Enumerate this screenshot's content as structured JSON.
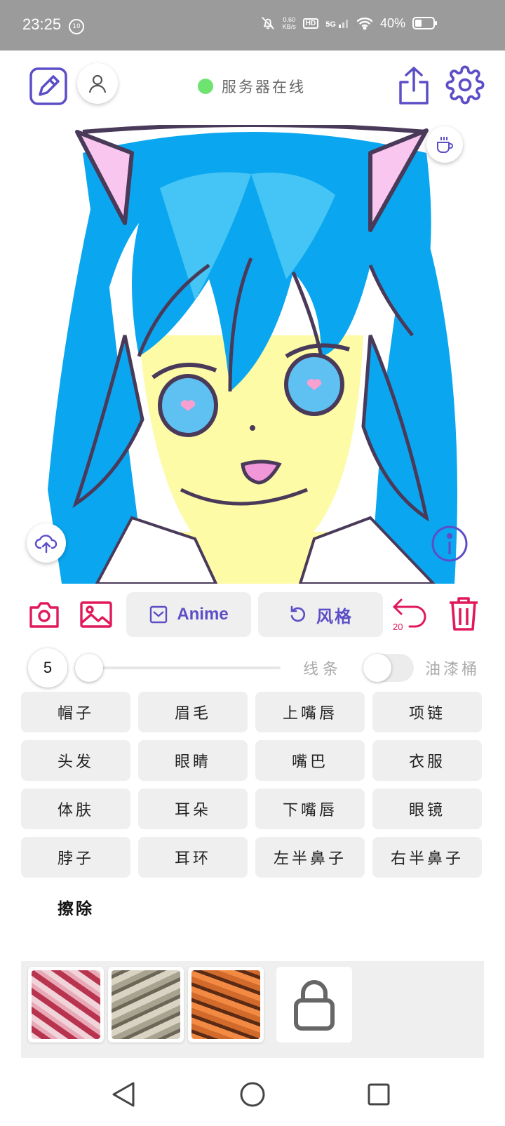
{
  "status_bar": {
    "time": "23:25",
    "notification_badge": "10",
    "net_speed_value": "0.60",
    "net_speed_unit": "KB/s",
    "hd_label": "HD",
    "signal_label": "5G",
    "battery": "40%"
  },
  "header": {
    "server_status": "服务器在线",
    "server_status_color": "#6fe36f"
  },
  "toolbar": {
    "anime_label": "Anime",
    "style_label": "风格",
    "undo_count": "20"
  },
  "brush": {
    "size": "5",
    "slider_fraction": 0.0,
    "line_label": "线条",
    "bucket_label": "油漆桶",
    "bucket_enabled": false
  },
  "parts": [
    "帽子",
    "眉毛",
    "上嘴唇",
    "项链",
    "头发",
    "眼睛",
    "嘴巴",
    "衣服",
    "体肤",
    "耳朵",
    "下嘴唇",
    "眼镜",
    "脖子",
    "耳环",
    "左半鼻子",
    "右半鼻子"
  ],
  "erase_label": "擦除",
  "colors": {
    "accent": "#5b4ec7",
    "danger": "#e0195a",
    "pill_bg": "#efefef"
  },
  "icons": {
    "draw": "pencil-square-icon",
    "profile": "user-icon",
    "share": "share-icon",
    "settings": "gear-icon",
    "coffee": "coffee-cup-icon",
    "upload": "cloud-upload-icon",
    "info": "info-icon",
    "camera": "camera-icon",
    "gallery": "image-icon",
    "undo": "undo-icon",
    "trash": "trash-icon",
    "lock": "lock-icon"
  }
}
